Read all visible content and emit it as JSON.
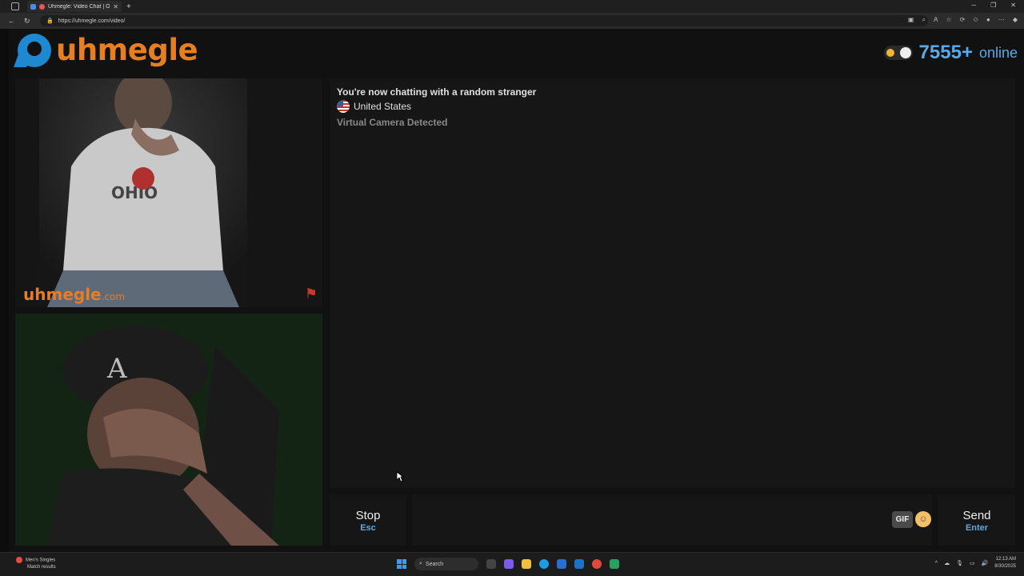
{
  "browser": {
    "tab_title": "Uhmegle: Video Chat | Ome",
    "tab_close": "✕",
    "new_tab": "+",
    "url": "https://uhmegle.com/video/"
  },
  "header": {
    "logo_text": "uhmegle",
    "online_count": "7555+",
    "online_label": "online"
  },
  "video": {
    "watermark": "uhmegle",
    "watermark_suffix": ".com"
  },
  "chat": {
    "status": "You're now chatting with a random stranger",
    "country": "United States",
    "notice": "Virtual Camera Detected"
  },
  "controls": {
    "stop_label": "Stop",
    "stop_key": "Esc",
    "send_label": "Send",
    "send_key": "Enter",
    "gif_label": "GIF",
    "message_placeholder": ""
  },
  "taskbar": {
    "news_title": "Men's Singles",
    "news_sub": "Match results",
    "search_label": "Search",
    "time": "12:13 AM",
    "date": "8/30/2025"
  },
  "colors": {
    "brand_orange": "#e67e22",
    "brand_blue": "#5aa9e6"
  }
}
